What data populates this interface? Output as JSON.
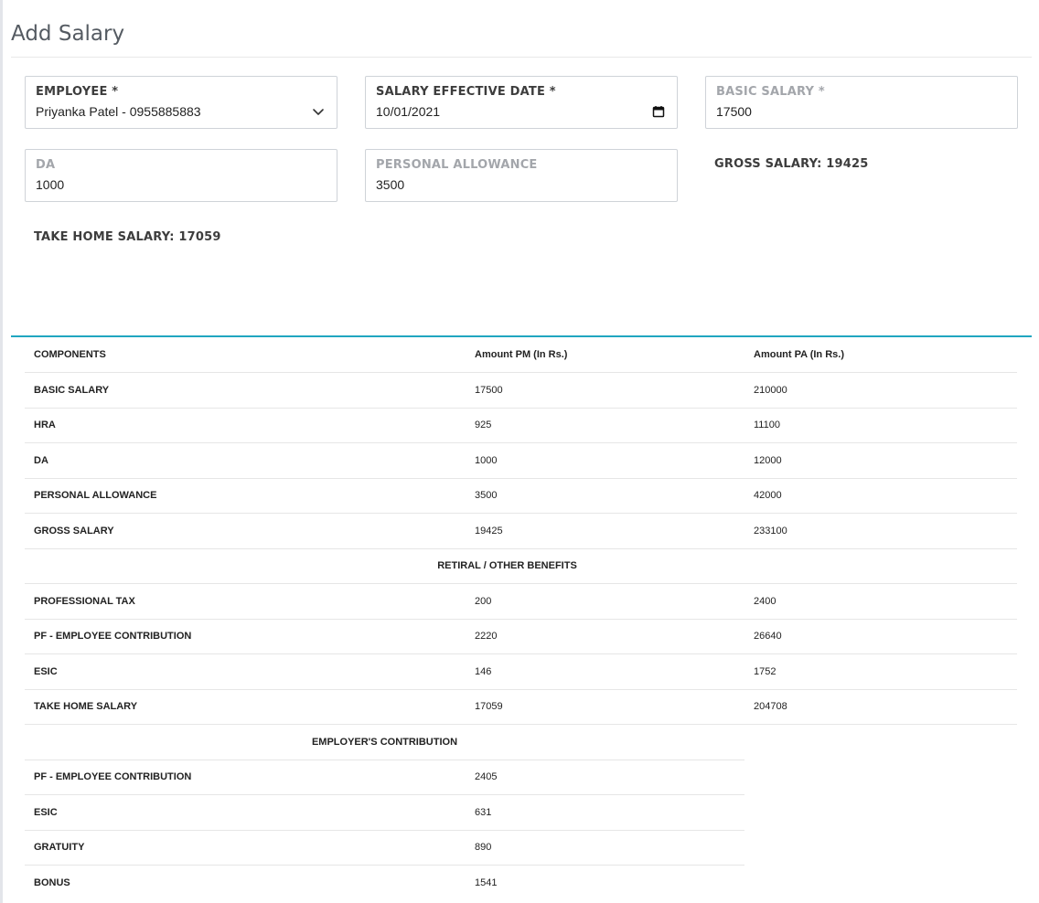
{
  "page": {
    "title": "Add Salary"
  },
  "form": {
    "employee": {
      "label": "EMPLOYEE *",
      "value": "Priyanka Patel - 0955885883"
    },
    "effective_date": {
      "label": "SALARY EFFECTIVE DATE *",
      "value": "10/01/2021"
    },
    "basic_salary": {
      "label": "BASIC SALARY *",
      "value": "17500"
    },
    "da": {
      "label": "DA",
      "value": "1000"
    },
    "personal_allowance": {
      "label": "PERSONAL ALLOWANCE",
      "value": "3500"
    },
    "gross_salary_text": "GROSS SALARY: 19425",
    "take_home_text": "TAKE HOME SALARY: 17059"
  },
  "table": {
    "headers": [
      "COMPONENTS",
      "Amount PM (In Rs.)",
      "Amount PA (In Rs.)"
    ],
    "earnings": [
      {
        "component": "BASIC SALARY",
        "pm": "17500",
        "pa": "210000"
      },
      {
        "component": "HRA",
        "pm": "925",
        "pa": "11100"
      },
      {
        "component": "DA",
        "pm": "1000",
        "pa": "12000"
      },
      {
        "component": "PERSONAL ALLOWANCE",
        "pm": "3500",
        "pa": "42000"
      },
      {
        "component": "GROSS SALARY",
        "pm": "19425",
        "pa": "233100"
      }
    ],
    "retiral_heading": "RETIRAL / OTHER BENEFITS",
    "retiral": [
      {
        "component": "PROFESSIONAL TAX",
        "pm": "200",
        "pa": "2400"
      },
      {
        "component": "PF - EMPLOYEE CONTRIBUTION",
        "pm": "2220",
        "pa": "26640"
      },
      {
        "component": "ESIC",
        "pm": "146",
        "pa": "1752"
      },
      {
        "component": "TAKE HOME SALARY",
        "pm": "17059",
        "pa": "204708"
      }
    ],
    "employer_heading": "EMPLOYER'S CONTRIBUTION",
    "employer": [
      {
        "component": "PF - EMPLOYEE CONTRIBUTION",
        "pm": "2405"
      },
      {
        "component": "ESIC",
        "pm": "631"
      },
      {
        "component": "GRATUITY",
        "pm": "890"
      },
      {
        "component": "BONUS",
        "pm": "1541"
      }
    ]
  },
  "icons": {
    "employee_select": "chevron-down-icon",
    "date_picker": "calendar-icon"
  },
  "colors": {
    "accent": "#20a6c0"
  }
}
